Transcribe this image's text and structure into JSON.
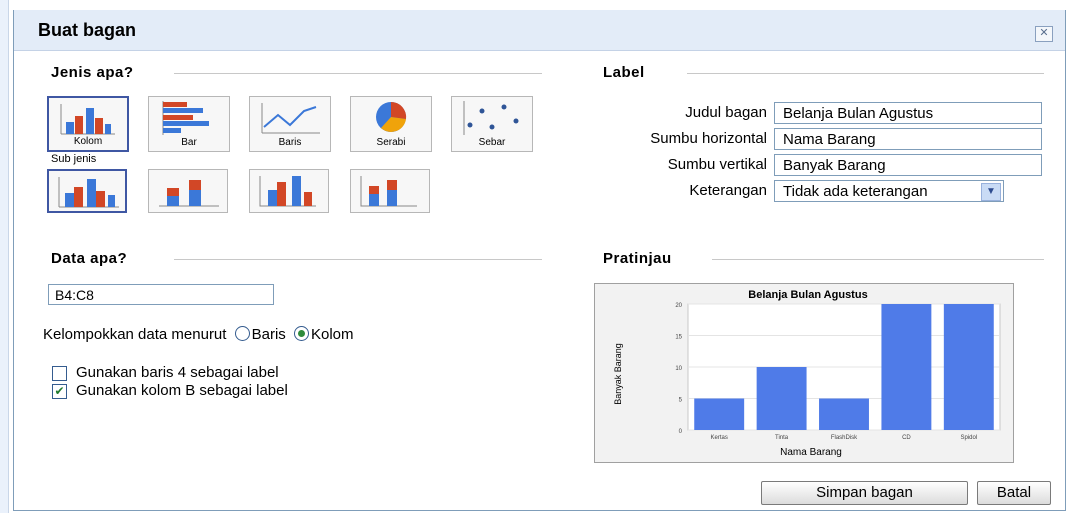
{
  "dialog": {
    "title": "Buat bagan",
    "close_icon": "close-icon"
  },
  "chart_type": {
    "heading": "Jenis apa?",
    "types": [
      {
        "label": "Kolom",
        "selected": true
      },
      {
        "label": "Bar",
        "selected": false
      },
      {
        "label": "Baris",
        "selected": false
      },
      {
        "label": "Serabi",
        "selected": false
      },
      {
        "label": "Sebar",
        "selected": false
      }
    ],
    "sub_heading": "Sub jenis",
    "subtypes": [
      "column-clustered",
      "column-stacked",
      "column-3d",
      "column-stacked-3d"
    ]
  },
  "labels": {
    "heading": "Label",
    "chart_title_label": "Judul bagan",
    "chart_title_value": "Belanja Bulan Agustus",
    "haxis_label": "Sumbu horizontal",
    "haxis_value": "Nama Barang",
    "vaxis_label": "Sumbu vertikal",
    "vaxis_value": "Banyak Barang",
    "legend_label": "Keterangan",
    "legend_value": "Tidak ada keterangan"
  },
  "data_section": {
    "heading": "Data apa?",
    "range": "B4:C8",
    "group_by_label": "Kelompokkan data menurut",
    "group_by_options": [
      "Baris",
      "Kolom"
    ],
    "group_by_selected": "Kolom",
    "use_row_label": "Gunakan baris 4 sebagai label",
    "use_row_checked": false,
    "use_col_label": "Gunakan kolom B sebagai label",
    "use_col_checked": true
  },
  "preview": {
    "heading": "Pratinjau"
  },
  "chart_data": {
    "type": "bar",
    "title": "Belanja Bulan Agustus",
    "xlabel": "Nama Barang",
    "ylabel": "Banyak Barang",
    "categories": [
      "Kertas",
      "Tinta",
      "FlashDisk",
      "CD",
      "Spidol"
    ],
    "values": [
      5,
      10,
      5,
      20,
      20
    ],
    "ylim": [
      0,
      20
    ],
    "yticks": [
      "0",
      "5",
      "10",
      "15",
      "20"
    ],
    "bar_color": "#4f7be8"
  },
  "footer": {
    "save_label": "Simpan bagan",
    "cancel_label": "Batal"
  }
}
